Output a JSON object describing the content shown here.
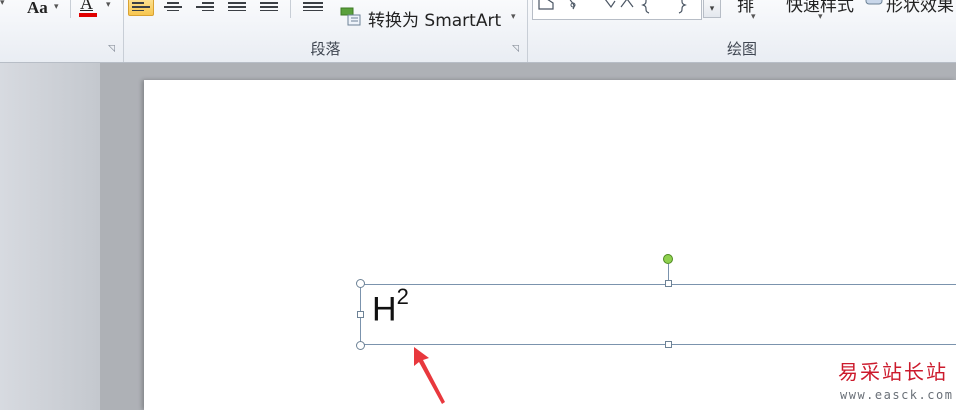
{
  "ribbon": {
    "font_group": {
      "change_case_label": "Aa",
      "font_color_label": "A",
      "font_color_swatch": "#e00000"
    },
    "paragraph_group": {
      "label": "段落",
      "convert_smartart_label": "转换为 SmartArt"
    },
    "drawing_group": {
      "label": "绘图",
      "arrange_label_fragment": "排",
      "quick_styles_label_fragment": "快速样式",
      "shape_effects_label_fragment": "形状效果"
    }
  },
  "slide": {
    "textbox": {
      "base_text": "H",
      "superscript_text": "2"
    }
  },
  "watermark": {
    "text": "易采站长站",
    "url": "www.easck.com"
  },
  "colors": {
    "accent_active": "#f7c64f",
    "selection_border": "#7b93ad",
    "rotate_handle": "#8fd14f",
    "annotation_arrow": "#e8383d"
  }
}
